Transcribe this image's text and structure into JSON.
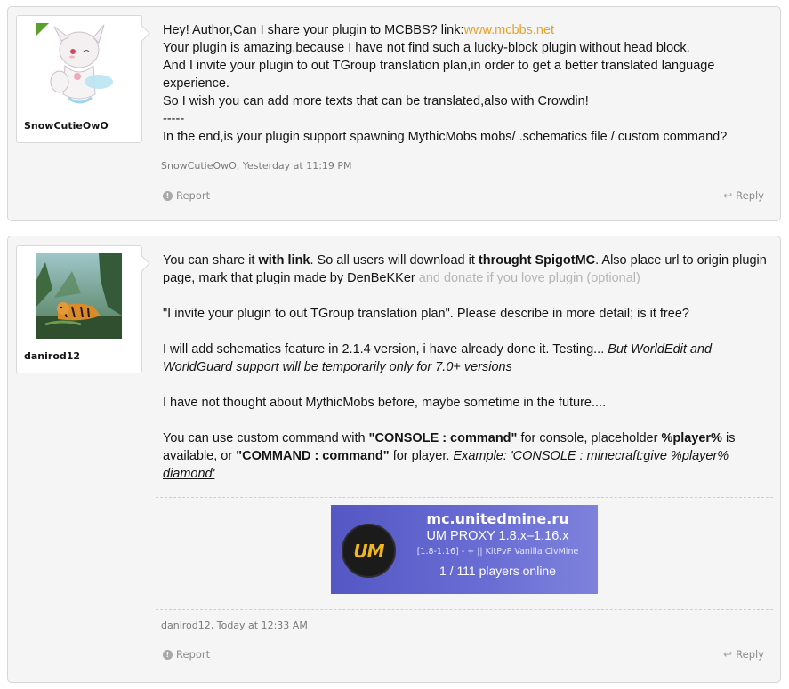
{
  "posts": [
    {
      "username": "SnowCutieOwO",
      "lines": {
        "l1_prefix": "Hey! Author,Can I share your plugin to MCBBS? link:",
        "l1_link": "www.mcbbs.net",
        "l2": "Your plugin is amazing,because I have not find such a lucky-block plugin without head block.",
        "l3": "And I invite your plugin to out TGroup translation plan,in order to get a better translated language experience.",
        "l4": "So I wish you can add more texts that can be translated,also with Crowdin!",
        "l5": "-----",
        "l6": "In the end,is your plugin support spawning MythicMobs mobs/ .schematics file / custom command?"
      },
      "meta": "SnowCutieOwO, Yesterday at 11:19 PM",
      "report_label": "Report",
      "reply_label": "Reply"
    },
    {
      "username": "danirod12",
      "p1": {
        "a": "You can share it ",
        "b": "with link",
        "c": ". So all users will download it ",
        "d": "throught SpigotMC",
        "e": ". Also place url to origin plugin page, mark that plugin made by DenBeKKer ",
        "f": "and donate if you love plugin (optional)"
      },
      "p2": "\"I invite your plugin to out TGroup translation plan\". Please describe in more detail; is it free?",
      "p3": {
        "a": "I will add schematics feature in 2.1.4 version, i have already done it. Testing... ",
        "b": "But WorldEdit and WorldGuard support will be temporarily only for 7.0+ versions"
      },
      "p4": "I have not thought about MythicMobs before, maybe sometime in the future....",
      "p5": {
        "a": "You can use custom command with ",
        "b": "\"CONSOLE : command\"",
        "c": " for console, placeholder ",
        "d": "%player%",
        "e": " is available, or ",
        "f": "\"COMMAND : command\"",
        "g": " for player. ",
        "h": "Example: 'CONSOLE : minecraft:give %player% diamond'"
      },
      "banner": {
        "logo": "UM",
        "title": "mc.unitedmine.ru",
        "subtitle": "UM PROXY 1.8.x–1.16.x",
        "motd": "[1.8-1.16] - + || KitPvP Vanilla CivMine",
        "online": "1 / 111 players online",
        "bg_color": "#5a5dc8",
        "logo_color": "#f2b61f"
      },
      "meta": "danirod12, Today at 12:33 AM",
      "report_label": "Report",
      "reply_label": "Reply"
    }
  ],
  "colors": {
    "link": "#e5a32a",
    "muted": "#b5b5b5",
    "post_bg": "#f5f5f5"
  }
}
